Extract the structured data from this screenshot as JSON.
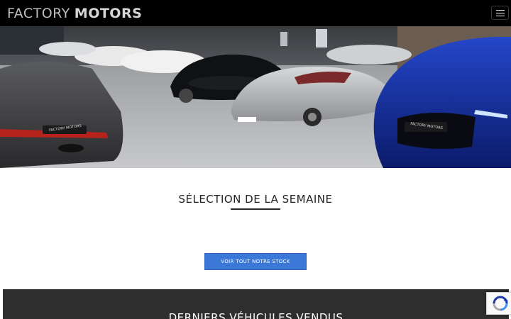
{
  "header": {
    "logo_word1": "FACTORY",
    "logo_word2": "MOTORS",
    "menu_icon": "hamburger-menu-icon"
  },
  "hero": {
    "image": "showroom-cars-photo",
    "plates": [
      "FACTORY MOTORS",
      "FACTORY MOTORS"
    ]
  },
  "featured": {
    "title": "SÉLECTION DE LA SEMAINE",
    "button_label": "VOIR TOUT NOTRE STOCK"
  },
  "sold": {
    "title": "DERNIERS VÉHICULES VENDUS"
  },
  "recaptcha": {
    "icon": "recaptcha-icon"
  },
  "colors": {
    "header_bg": "#000000",
    "button_bg": "#3c78d8",
    "sold_bg": "#2e2e2e"
  }
}
